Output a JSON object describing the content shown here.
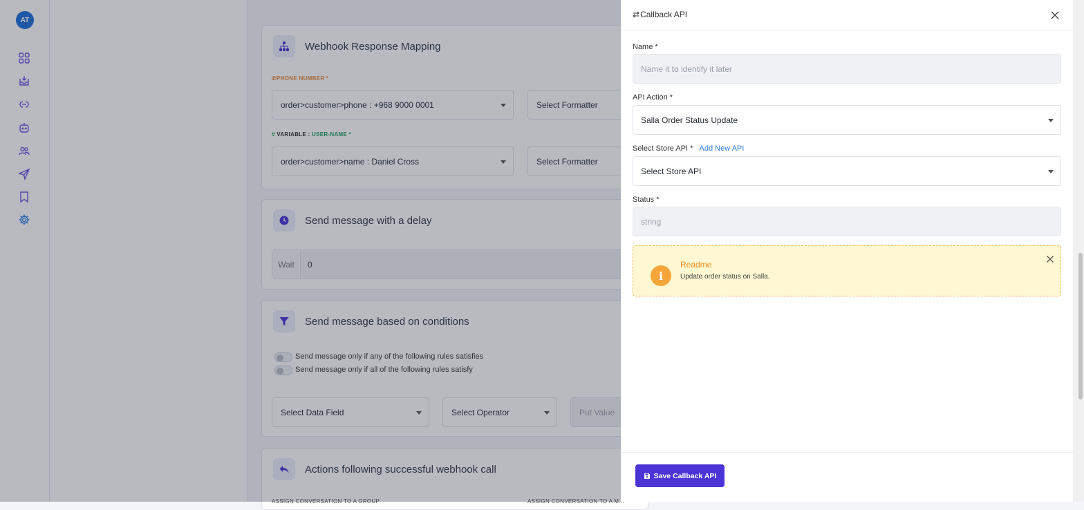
{
  "sidebar": {
    "avatar_initials": "AT",
    "icons": [
      "dashboard-icon",
      "inbox-icon",
      "integrations-icon",
      "bot-icon",
      "contacts-icon",
      "campaigns-icon",
      "templates-icon",
      "settings-icon"
    ]
  },
  "main": {
    "webhook_mapping": {
      "title": "Webhook Response Mapping",
      "phone_label": "PHONE NUMBER *",
      "phone_value": "order>customer>phone : +968 9000 0001",
      "phone_formatter": "Select Formatter",
      "variable_label_prefix": "VARIABLE :",
      "variable_label_name": "USER-NAME *",
      "variable_value": "order>customer>name : Daniel Cross",
      "variable_formatter": "Select Formatter"
    },
    "delay": {
      "title": "Send message with a delay",
      "wait_label": "Wait",
      "wait_value": "0"
    },
    "conditions": {
      "title": "Send message based on conditions",
      "toggle_any": "Send message only if any of the following rules satisfies",
      "toggle_all": "Send message only if all of the following rules satisfy",
      "data_field": "Select Data Field",
      "operator": "Select Operator",
      "value_placeholder": "Put Value"
    },
    "actions": {
      "title": "Actions following successful webhook call",
      "label_group": "ASSIGN CONVERSATION TO A GROUP",
      "label_agent": "ASSIGN CONVERSATION TO A M..."
    }
  },
  "drawer": {
    "title": "Callback API",
    "name_label": "Name *",
    "name_placeholder": "Name it to identify it later",
    "api_action_label": "API Action *",
    "api_action_value": "Salla Order Status Update",
    "store_api_label": "Select Store API *",
    "add_new_api": "Add New API",
    "store_api_value": "Select Store API",
    "status_label": "Status *",
    "status_placeholder": "string",
    "readme_title": "Readme",
    "readme_text": "Update order status on Salla.",
    "save_label": "Save Callback API"
  },
  "colors": {
    "accent": "#4a34d6",
    "phone_label": "#e8893a",
    "variable_label": "#1f9d55",
    "readme_bg": "#fff8d2",
    "readme_title": "#f08c1a",
    "link": "#2f7fe0"
  }
}
